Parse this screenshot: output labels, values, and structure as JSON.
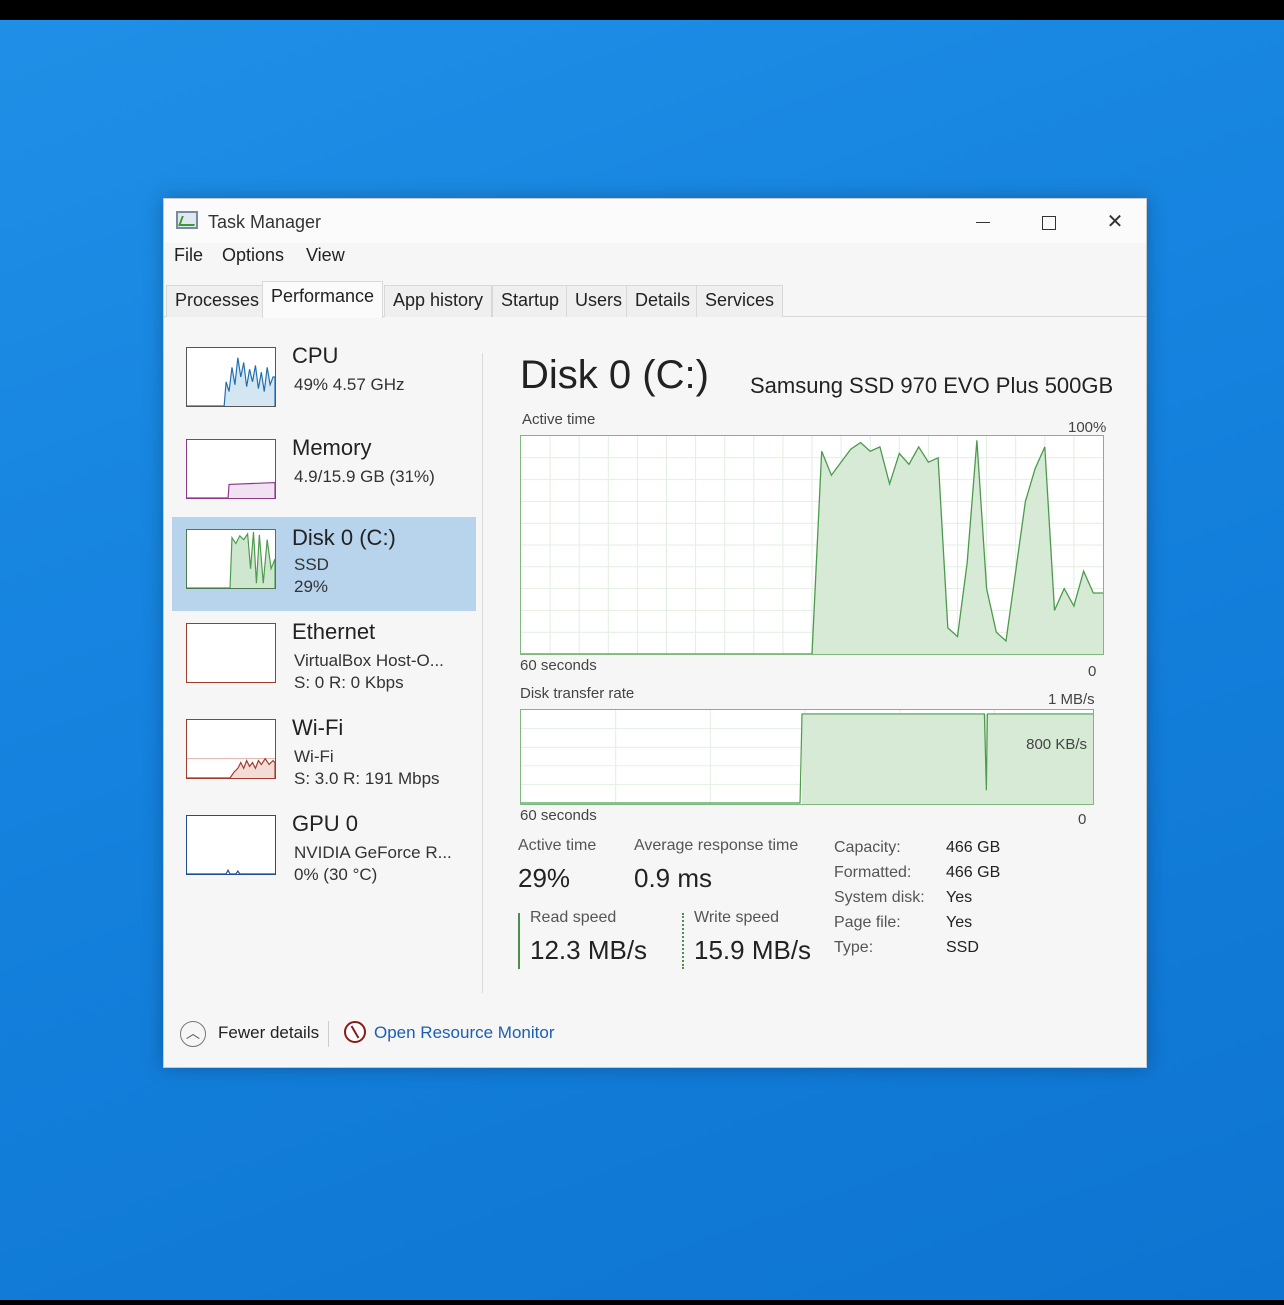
{
  "window": {
    "title": "Task Manager"
  },
  "menu": [
    "File",
    "Options",
    "View"
  ],
  "tabs": [
    "Processes",
    "Performance",
    "App history",
    "Startup",
    "Users",
    "Details",
    "Services"
  ],
  "active_tab": "Performance",
  "sidebar": [
    {
      "name": "CPU",
      "line1": "49% 4.57 GHz",
      "line2": "",
      "color": "#1f6fb0"
    },
    {
      "name": "Memory",
      "line1": "4.9/15.9 GB (31%)",
      "line2": "",
      "color": "#8b3a8b"
    },
    {
      "name": "Disk 0 (C:)",
      "line1": "SSD",
      "line2": "29%",
      "color": "#4c9a4c"
    },
    {
      "name": "Ethernet",
      "line1": "VirtualBox Host-O...",
      "line2": "S: 0 R: 0 Kbps",
      "color": "#a03a2a"
    },
    {
      "name": "Wi-Fi",
      "line1": "Wi-Fi",
      "line2": "S: 3.0 R: 191 Mbps",
      "color": "#a03a2a"
    },
    {
      "name": "GPU 0",
      "line1": "NVIDIA GeForce R...",
      "line2": "0% (30 °C)",
      "color": "#1f4f90"
    }
  ],
  "main": {
    "title": "Disk 0 (C:)",
    "model": "Samsung SSD 970 EVO Plus 500GB",
    "active_time_label": "Active time",
    "active_time_max": "100%",
    "seconds_label": "60 seconds",
    "zero": "0",
    "transfer_label": "Disk transfer rate",
    "transfer_max": "1 MB/s",
    "transfer_mid": "800 KB/s"
  },
  "stats": {
    "active_time_label": "Active time",
    "active_time_value": "29%",
    "avg_response_label": "Average response time",
    "avg_response_value": "0.9 ms",
    "read_label": "Read speed",
    "read_value": "12.3 MB/s",
    "write_label": "Write speed",
    "write_value": "15.9 MB/s"
  },
  "properties": [
    {
      "key": "Capacity:",
      "value": "466 GB"
    },
    {
      "key": "Formatted:",
      "value": "466 GB"
    },
    {
      "key": "System disk:",
      "value": "Yes"
    },
    {
      "key": "Page file:",
      "value": "Yes"
    },
    {
      "key": "Type:",
      "value": "SSD"
    }
  ],
  "footer": {
    "fewer_details": "Fewer details",
    "open_resource_monitor": "Open Resource Monitor"
  },
  "chart_data": {
    "type": "area",
    "title": "",
    "xlabel": "60 seconds",
    "ylabel": "Active time",
    "ylim": [
      0,
      100
    ],
    "x": [
      0,
      3,
      6,
      9,
      12,
      15,
      18,
      21,
      24,
      27,
      29,
      30,
      31,
      32,
      33,
      34,
      35,
      36,
      37,
      38,
      39,
      40,
      41,
      42,
      43,
      44,
      45,
      46,
      47,
      48,
      49,
      50,
      51,
      52,
      53,
      54,
      55,
      56,
      57,
      58,
      59,
      60
    ],
    "series": [
      {
        "values": [
          0,
          0,
          0,
          0,
          0,
          0,
          0,
          0,
          0,
          0,
          0,
          0,
          93,
          82,
          88,
          94,
          97,
          93,
          95,
          78,
          92,
          87,
          95,
          88,
          90,
          12,
          8,
          42,
          98,
          30,
          10,
          6,
          38,
          70,
          85,
          95,
          20,
          30,
          22,
          38,
          28,
          28
        ]
      }
    ]
  }
}
